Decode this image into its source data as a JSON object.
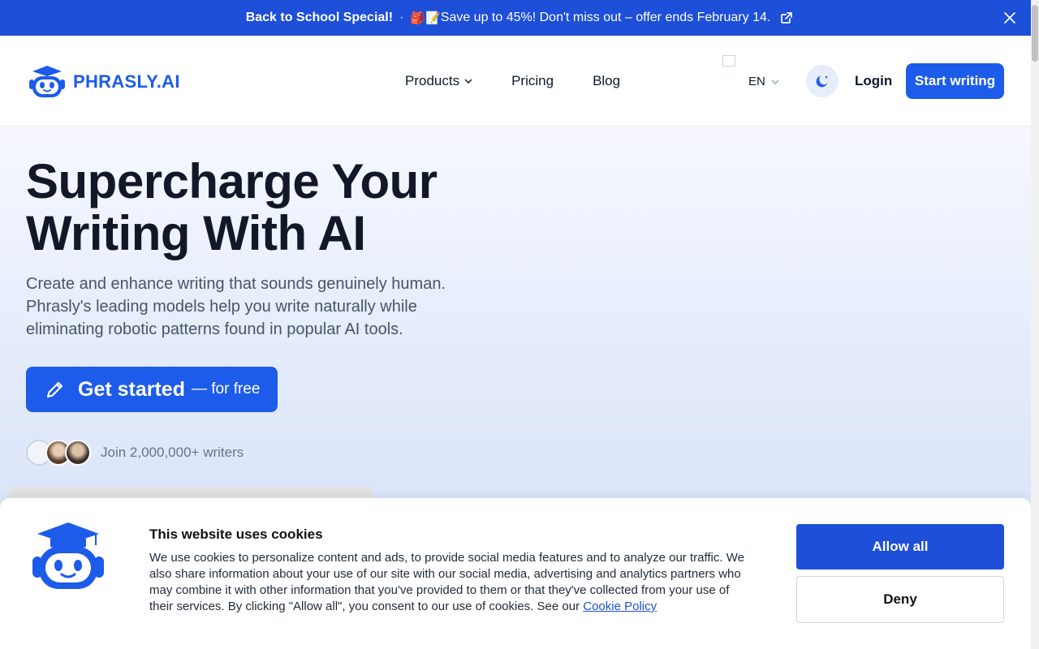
{
  "promo": {
    "title": "Back to School Special!",
    "separator": "·",
    "emojis": "🎒📝",
    "text": "Save up to 45%! Don't miss out – offer ends February 14.",
    "external_icon": "external-link-icon",
    "close_icon": "close-icon"
  },
  "header": {
    "logo_text": "PHRASLY.AI",
    "nav": {
      "products": "Products",
      "pricing": "Pricing",
      "blog": "Blog"
    },
    "language": "EN",
    "theme_icon": "moon-icon",
    "login": "Login",
    "start_writing": "Start writing"
  },
  "hero": {
    "headline_line1": "Supercharge Your",
    "headline_line2": "Writing With AI",
    "subtitle": "Create and enhance writing that sounds genuinely human. Phrasly's leading models help you write naturally while eliminating robotic patterns found in popular AI tools.",
    "cta_main": "Get started",
    "cta_suffix": "— for free",
    "social_proof": "Join 2,000,000+ writers"
  },
  "cookie": {
    "title": "This website uses cookies",
    "body": "We use cookies to personalize content and ads, to provide social media features and to analyze our traffic. We also share information about your use of our site with our social media, advertising and analytics partners who may combine it with other information that you've provided to them or that they've collected from your use of their services. By clicking \"Allow all\", you consent to our use of cookies. See our ",
    "link": "Cookie Policy",
    "allow_all": "Allow all",
    "deny": "Deny"
  },
  "colors": {
    "brand_blue": "#1d5bea",
    "banner_blue": "#1d4fd8"
  }
}
